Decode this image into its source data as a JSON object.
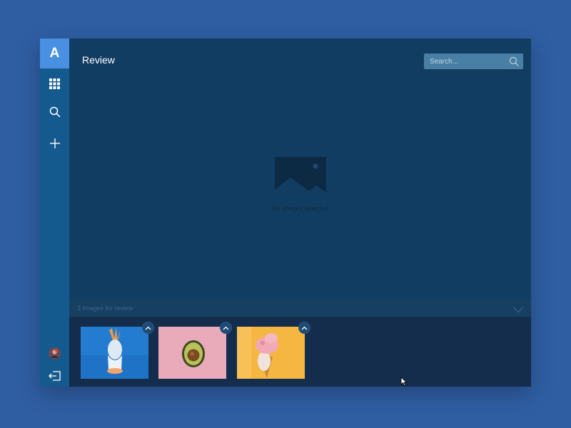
{
  "app": {
    "logo_letter": "A",
    "title": "Review"
  },
  "search": {
    "placeholder": "Search..."
  },
  "sidebar": {
    "items": [
      {
        "icon": "grid-icon"
      },
      {
        "icon": "search-icon"
      },
      {
        "icon": "plus-icon"
      }
    ],
    "bottom": [
      {
        "icon": "avatar"
      },
      {
        "icon": "logout-icon"
      }
    ]
  },
  "main": {
    "empty_icon": "image-placeholder-icon",
    "empty_text": "No images selected"
  },
  "tray": {
    "header_label": "3 Images for review",
    "toggle_icon": "chevron-down-icon",
    "thumbnails": [
      {
        "subject": "pineapple",
        "background": "#1e73c7"
      },
      {
        "subject": "avocado",
        "background": "#e9aab9"
      },
      {
        "subject": "ice-cream-cone",
        "background": "#f5b741"
      }
    ]
  },
  "colors": {
    "page_background": "#2f5ea3",
    "sidebar": "#155a8f",
    "accent": "#4a90e2",
    "main_panel": "#123d62",
    "tray": "#152d4d"
  }
}
